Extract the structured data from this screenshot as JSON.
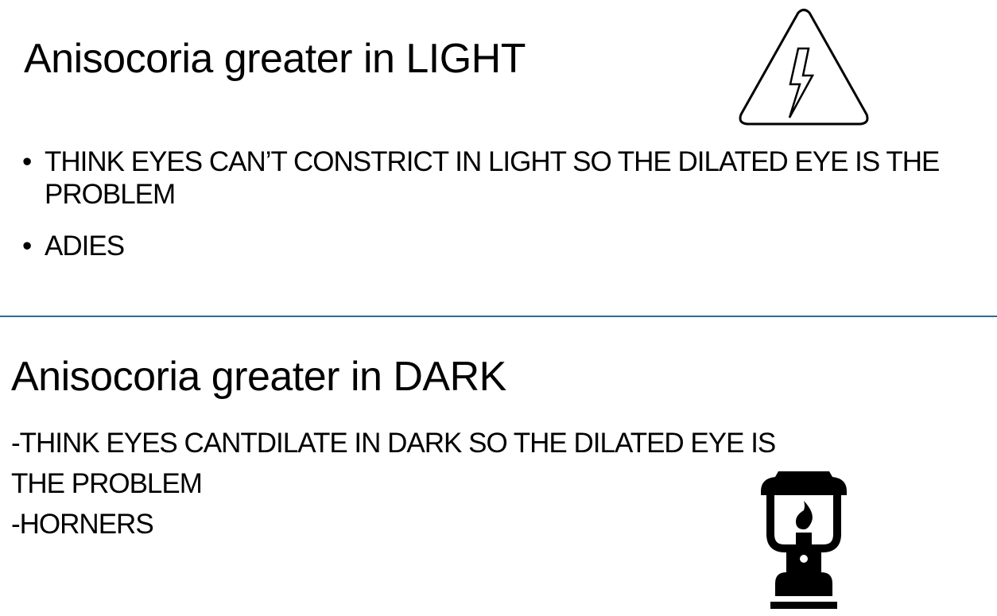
{
  "light_section": {
    "title": "Anisocoria greater in LIGHT",
    "bullets": [
      "THINK EYES CAN’T CONSTRICT IN LIGHT SO THE DILATED EYE IS THE PROBLEM",
      "ADIES"
    ],
    "icon": "high-voltage-warning-icon"
  },
  "dark_section": {
    "title": "Anisocoria greater in DARK",
    "lines": [
      "-THINK EYES CANTDILATE IN DARK SO THE DILATED EYE IS",
      "THE PROBLEM",
      "-HORNERS"
    ],
    "icon": "lantern-icon"
  },
  "colors": {
    "divider": "#2e6a8e"
  }
}
